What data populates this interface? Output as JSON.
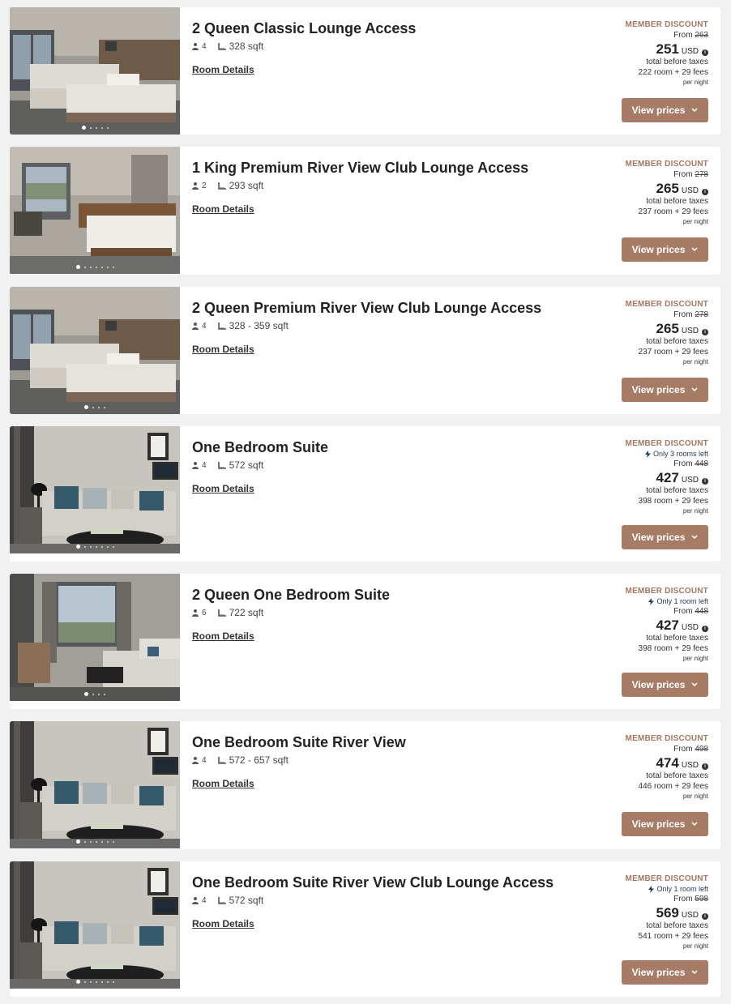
{
  "labels": {
    "room_details": "Room Details",
    "view_prices": "View prices",
    "member_discount": "MEMBER DISCOUNT",
    "from": "From",
    "currency": "USD",
    "total_before_taxes": "total before taxes",
    "room_word": "room +",
    "fees_word": "fees",
    "per_night": "per night"
  },
  "icons": {
    "guests": "person-icon",
    "size": "ruler-icon",
    "info": "info-icon",
    "availability": "lightning-icon",
    "dropdown": "chevron-down-icon"
  },
  "colors": {
    "accent": "#a67c67",
    "discount_text": "#a27863",
    "availability_text": "#1e3a5a",
    "background": "#f1f1f1",
    "card": "#ffffff"
  },
  "rooms": [
    {
      "title": "2 Queen Classic Lounge Access",
      "guests": "4",
      "size": "328 sqft",
      "availability": "",
      "original_price": "263",
      "price": "251",
      "room_amount": "222",
      "fees_amount": "29",
      "photo": "two-queen-beds",
      "photo_count": 5,
      "active_photo": 0
    },
    {
      "title": "1 King Premium River View Club Lounge Access",
      "guests": "2",
      "size": "293 sqft",
      "availability": "",
      "original_price": "278",
      "price": "265",
      "room_amount": "237",
      "fees_amount": "29",
      "photo": "king-bed",
      "photo_count": 7,
      "active_photo": 0
    },
    {
      "title": "2 Queen Premium River View Club Lounge Access",
      "guests": "4",
      "size": "328 - 359 sqft",
      "availability": "",
      "original_price": "278",
      "price": "265",
      "room_amount": "237",
      "fees_amount": "29",
      "photo": "two-queen-beds",
      "photo_count": 4,
      "active_photo": 0
    },
    {
      "title": "One Bedroom Suite",
      "guests": "4",
      "size": "572 sqft",
      "availability": "Only 3 rooms left",
      "original_price": "448",
      "price": "427",
      "room_amount": "398",
      "fees_amount": "29",
      "photo": "living-room",
      "photo_count": 7,
      "active_photo": 0
    },
    {
      "title": "2 Queen One Bedroom Suite",
      "guests": "6",
      "size": "722 sqft",
      "availability": "Only 1 room left",
      "original_price": "448",
      "price": "427",
      "room_amount": "398",
      "fees_amount": "29",
      "photo": "suite-window",
      "photo_count": 4,
      "active_photo": 0
    },
    {
      "title": "One Bedroom Suite River View",
      "guests": "4",
      "size": "572 - 657 sqft",
      "availability": "",
      "original_price": "498",
      "price": "474",
      "room_amount": "446",
      "fees_amount": "29",
      "photo": "living-room",
      "photo_count": 7,
      "active_photo": 0
    },
    {
      "title": "One Bedroom Suite River View Club Lounge Access",
      "guests": "4",
      "size": "572 sqft",
      "availability": "Only 1 room left",
      "original_price": "598",
      "price": "569",
      "room_amount": "541",
      "fees_amount": "29",
      "photo": "living-room",
      "photo_count": 7,
      "active_photo": 0
    }
  ]
}
